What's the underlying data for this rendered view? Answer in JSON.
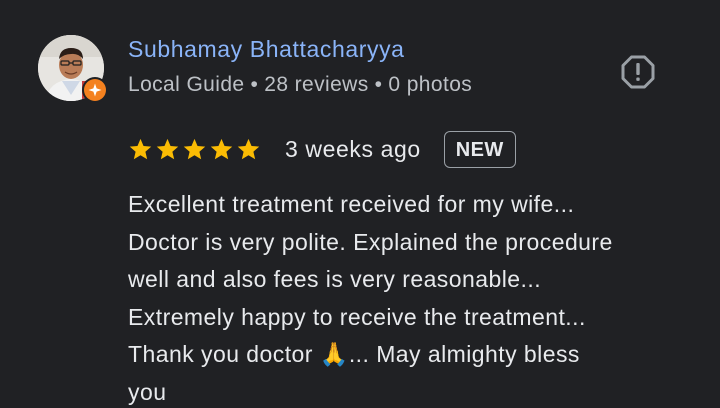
{
  "reviewer": {
    "name": "Subhamay Bhattacharyya",
    "badge_icon": "local-guide-icon",
    "avatar_icon": "profile-photo",
    "meta": {
      "role": "Local Guide",
      "separator": "•",
      "reviews": "28 reviews",
      "photos": "0 photos"
    }
  },
  "actions": {
    "report_icon": "report-icon"
  },
  "rating": {
    "stars": 5,
    "max": 5,
    "star_color": "#fbbc04",
    "time": "3 weeks ago",
    "badge": "NEW"
  },
  "review": {
    "lines": [
      "Excellent treatment received for my wife...",
      "Doctor is very polite. Explained the procedure",
      "well and also fees is very reasonable...",
      "Extremely happy to receive the treatment...",
      "Thank you doctor 🙏... May almighty bless",
      "you"
    ]
  },
  "colors": {
    "background": "#202124",
    "name": "#8ab4f8",
    "meta": "#bdc1c6",
    "text": "#e8eaed",
    "guide_badge": "#f4811f"
  }
}
